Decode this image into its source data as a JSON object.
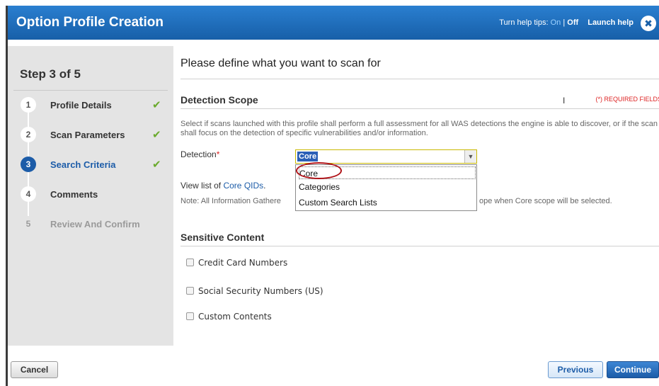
{
  "header": {
    "title": "Option Profile Creation",
    "help_prefix": "Turn help tips:",
    "help_on": "On",
    "help_sep": " | ",
    "help_off": "Off",
    "launch_help": "Launch help",
    "close_glyph": "✖"
  },
  "sidebar": {
    "step_title": "Step 3 of 5",
    "steps": [
      {
        "num": "1",
        "label": "Profile Details",
        "done": true
      },
      {
        "num": "2",
        "label": "Scan Parameters",
        "done": true
      },
      {
        "num": "3",
        "label": "Search Criteria",
        "done": true
      },
      {
        "num": "4",
        "label": "Comments",
        "done": false
      },
      {
        "num": "5",
        "label": "Review And Confirm",
        "done": false
      }
    ],
    "check_glyph": "✔"
  },
  "main": {
    "heading": "Please define what you want to scan for",
    "detection_scope_title": "Detection Scope",
    "required_note": "(*) REQUIRED FIELDS",
    "description": "Select if scans launched with this profile shall perform a full assessment for all WAS detections the engine is able to discover, or if the scan shall focus on the detection of specific vulnerabilities and/or information.",
    "detection_label": "Detection",
    "required_star": "*",
    "detection_value": "Core",
    "detection_options": [
      "Core",
      "Categories",
      "Custom Search Lists"
    ],
    "view_list_prefix": "View list of ",
    "view_list_link": "Core QIDs",
    "view_list_suffix": ".",
    "note_left": "Note: All Information Gathere",
    "note_right": "ope when Core scope will be selected.",
    "sensitive_title": "Sensitive Content",
    "checkboxes": [
      "Credit Card Numbers",
      "Social Security Numbers (US)",
      "Custom Contents"
    ]
  },
  "footer": {
    "cancel": "Cancel",
    "previous": "Previous",
    "continue": "Continue"
  },
  "colors": {
    "titlebar": "#1f6fbf",
    "accent": "#1c5ca8",
    "check": "#6aaa2c",
    "required": "#dd2222",
    "highlight_oval": "#b01217"
  }
}
